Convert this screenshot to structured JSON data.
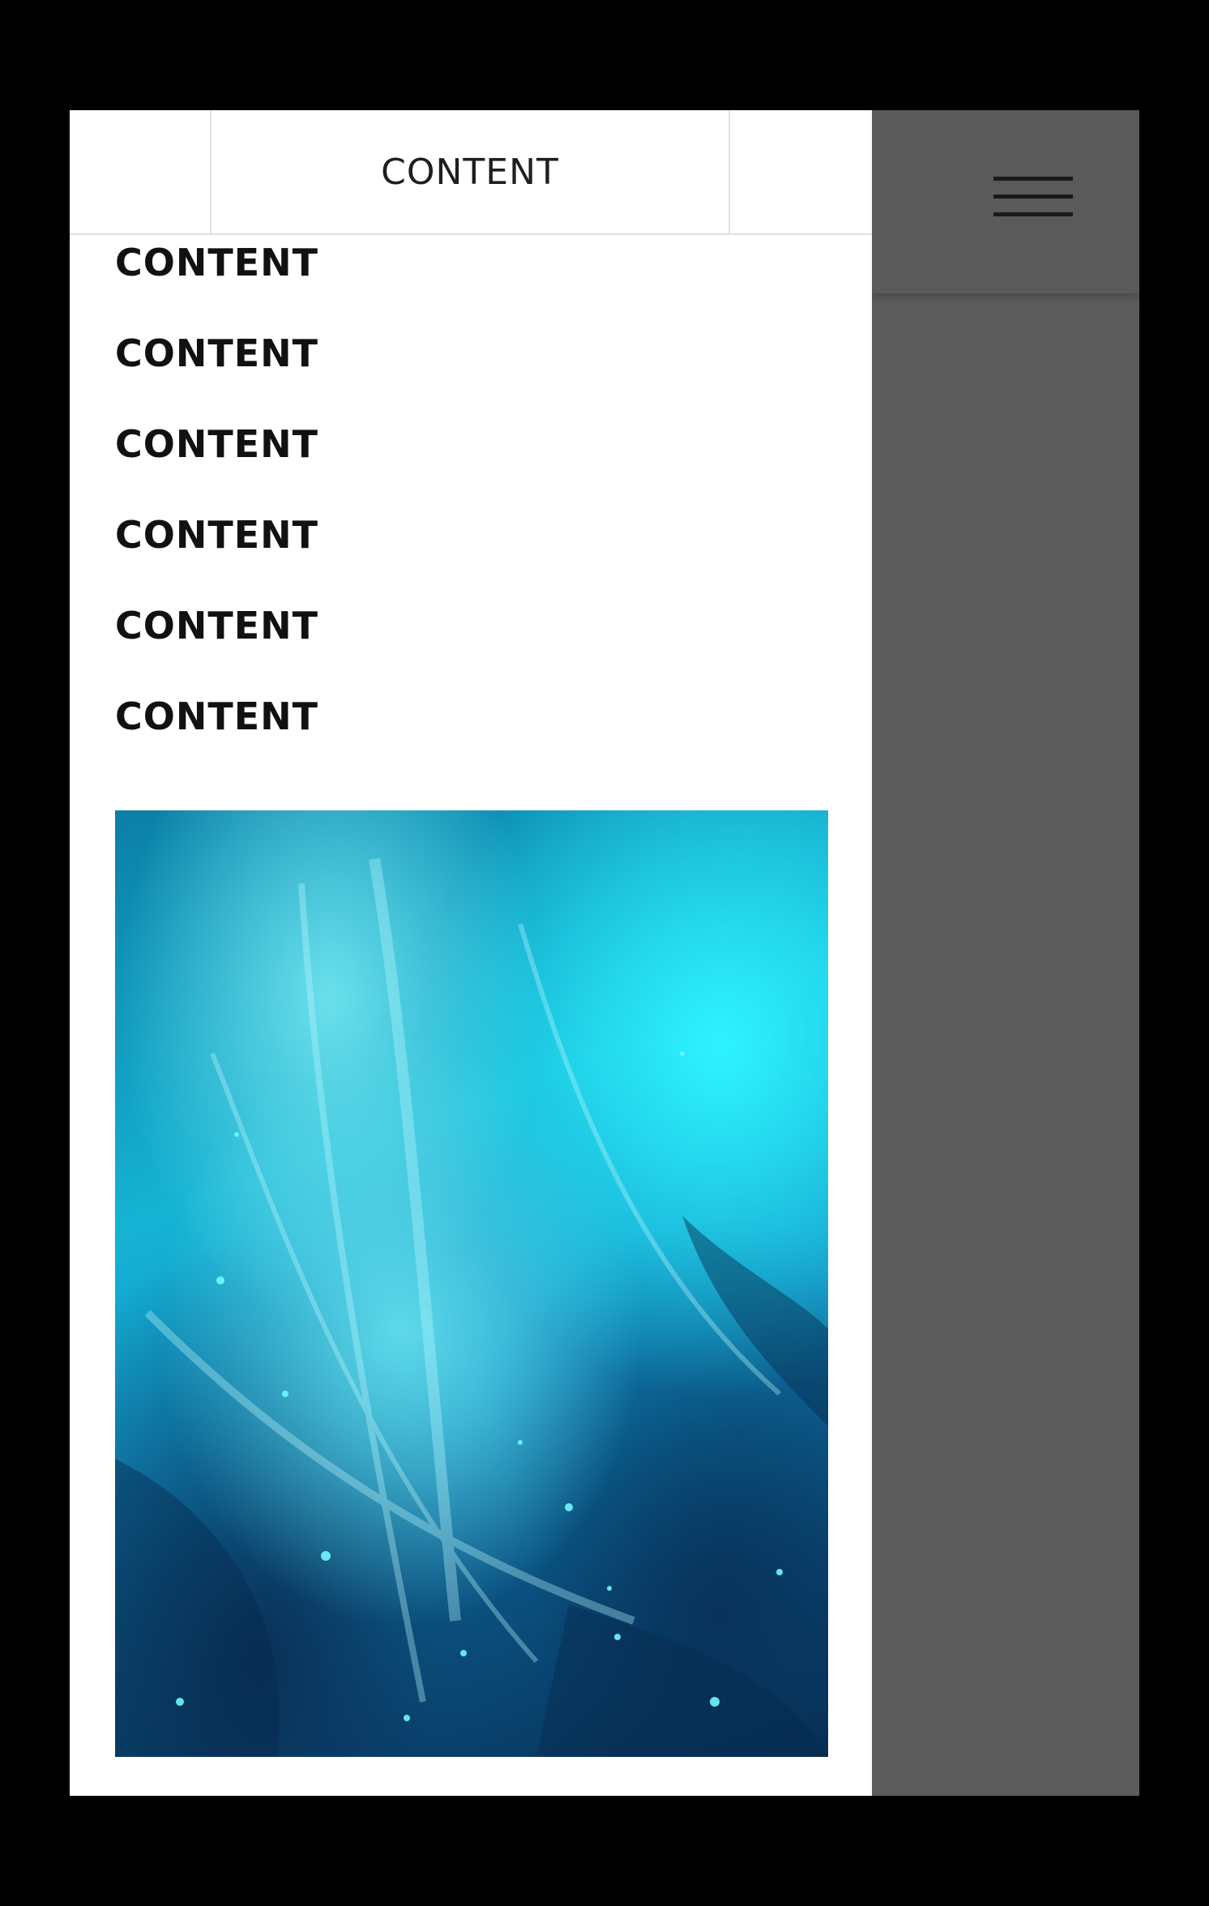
{
  "header": {
    "title": "CONTENT"
  },
  "menu": {
    "items": [
      {
        "label": "CONTENT"
      },
      {
        "label": "CONTENT"
      },
      {
        "label": "CONTENT"
      },
      {
        "label": "CONTENT"
      },
      {
        "label": "CONTENT"
      },
      {
        "label": "CONTENT"
      }
    ]
  },
  "icons": {
    "menu": "hamburger-menu-icon"
  },
  "colors": {
    "overlay": "#5c5c5c",
    "drawer_bg": "#ffffff",
    "text": "#111111",
    "image_accent": "#1ec6e6"
  }
}
